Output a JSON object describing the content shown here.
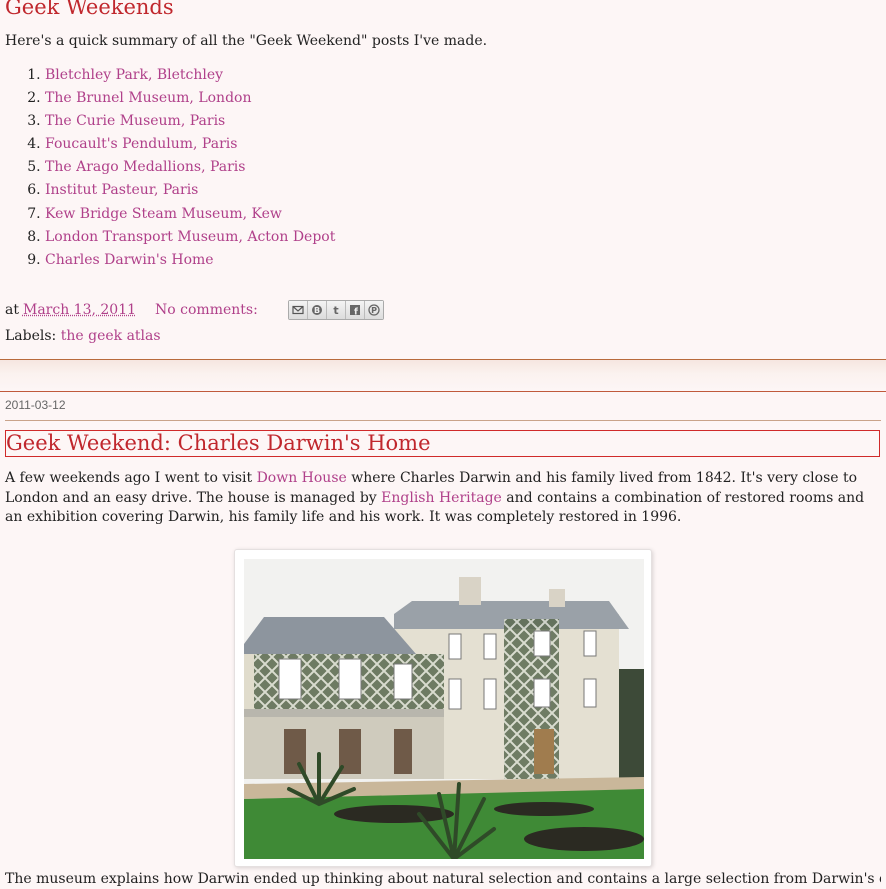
{
  "post1": {
    "title": "Geek Weekends",
    "intro": "Here's a quick summary of all the \"Geek Weekend\" posts I've made.",
    "items": [
      "Bletchley Park, Bletchley",
      "The Brunel Museum, London",
      "The Curie Museum, Paris",
      "Foucault's Pendulum, Paris",
      "The Arago Medallions, Paris",
      "Institut Pasteur, Paris",
      "Kew Bridge Steam Museum, Kew",
      "London Transport Museum, Acton Depot",
      "Charles Darwin's Home"
    ],
    "footer": {
      "at": "at",
      "date": "March 13, 2011",
      "comments": "No comments:",
      "share_icons": [
        "email-icon",
        "blogger-icon",
        "twitter-icon",
        "facebook-icon",
        "pinterest-icon"
      ]
    },
    "labels_prefix": "Labels:",
    "label": "the geek atlas"
  },
  "post2": {
    "date": "2011-03-12",
    "title": "Geek Weekend: Charles Darwin's Home",
    "para": {
      "t1": "A few weekends ago I went to visit ",
      "link1": "Down House",
      "t2": " where Charles Darwin and his family lived from 1842. It's very close to London and an easy drive. The house is managed by ",
      "link2": "English Heritage",
      "t3": " and contains a combination of restored rooms and an exhibition covering Darwin, his family life and his work. It was completely restored in 1996."
    },
    "last_para": "The museum explains how Darwin ended up thinking about natural selection and contains a large selection from Darwin's own"
  },
  "colors": {
    "background": "#fdf6f6",
    "title": "#c0272d",
    "link": "#b0408a"
  }
}
